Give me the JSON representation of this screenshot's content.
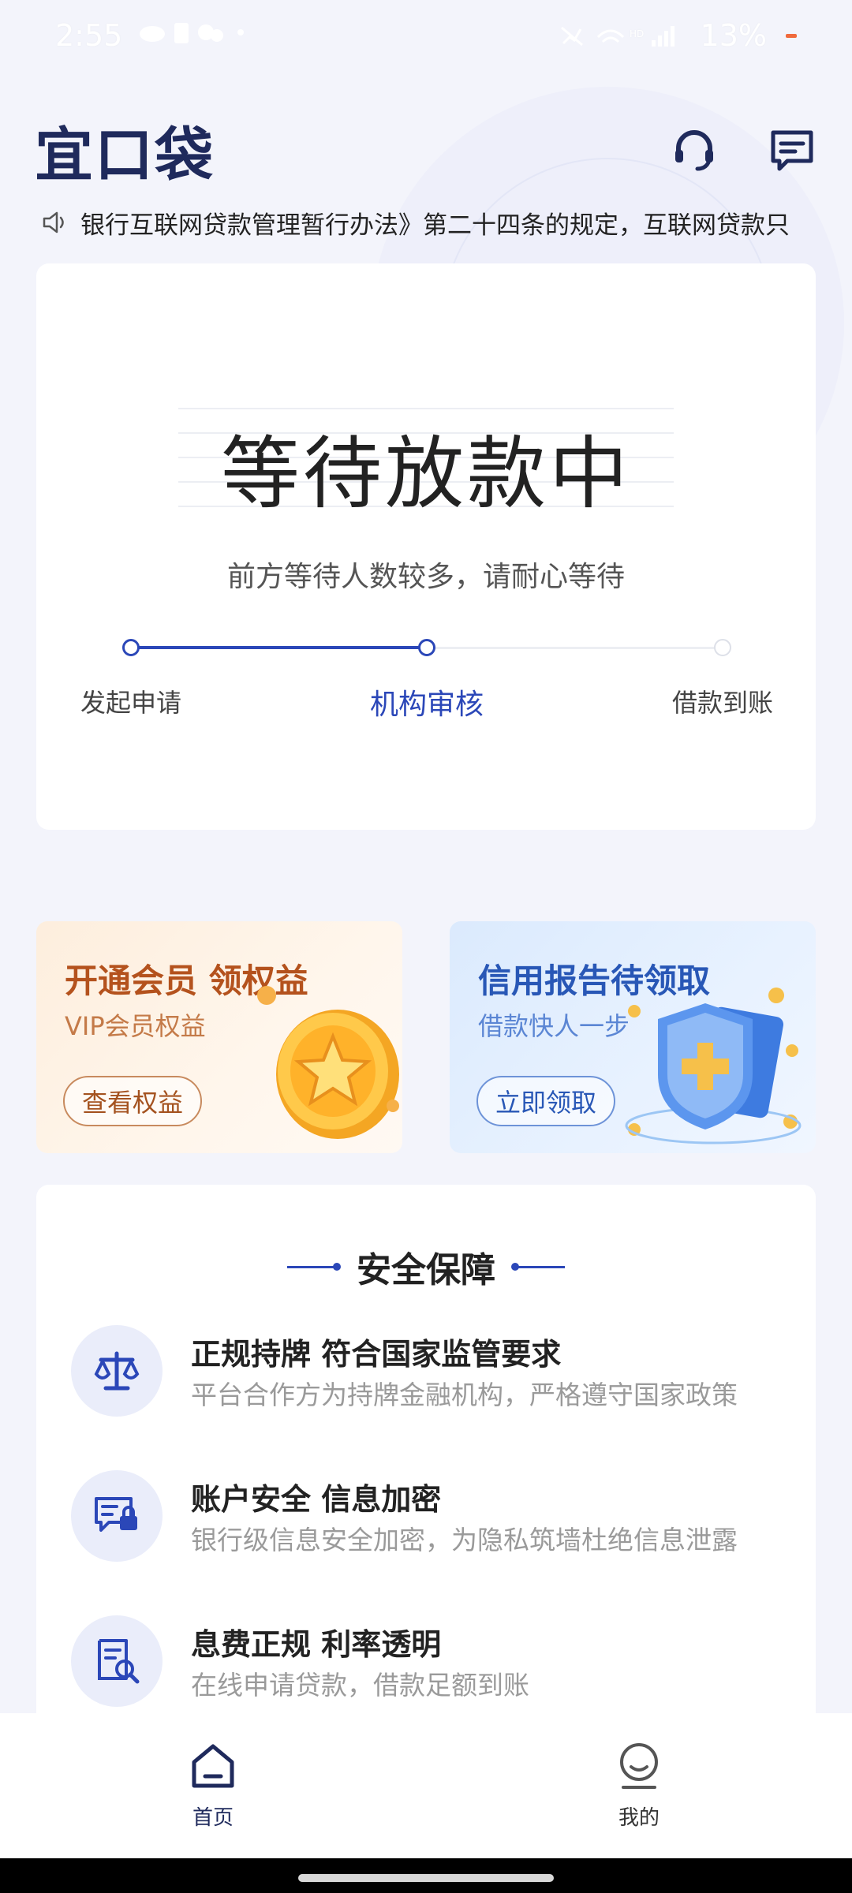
{
  "status_bar": {
    "time": "2:55",
    "battery": "13%"
  },
  "header": {
    "logo": "宜口袋"
  },
  "notice": {
    "text": "银行互联网贷款管理暂行办法》第二十四条的规定，互联网贷款只"
  },
  "loan_status": {
    "title": "等待放款中",
    "subtitle": "前方等待人数较多，请耐心等待",
    "steps": [
      "发起申请",
      "机构审核",
      "借款到账"
    ],
    "active_step": 1
  },
  "promos": {
    "vip": {
      "title": "开通会员 领权益",
      "subtitle": "VIP会员权益",
      "button": "查看权益"
    },
    "credit": {
      "title": "信用报告待领取",
      "subtitle": "借款快人一步",
      "button": "立即领取"
    }
  },
  "security": {
    "title": "安全保障",
    "items": [
      {
        "title": "正规持牌 符合国家监管要求",
        "desc": "平台合作方为持牌金融机构，严格遵守国家政策",
        "icon": "scale-icon"
      },
      {
        "title": "账户安全 信息加密",
        "desc": "银行级信息安全加密，为隐私筑墙杜绝信息泄露",
        "icon": "secure-message-icon"
      },
      {
        "title": "息费正规  利率透明",
        "desc": "在线申请贷款，借款足额到账",
        "icon": "document-search-icon"
      }
    ]
  },
  "bottom_nav": {
    "items": [
      {
        "label": "首页",
        "icon": "home-icon",
        "active": true
      },
      {
        "label": "我的",
        "icon": "profile-icon",
        "active": false
      }
    ]
  },
  "colors": {
    "primary": "#2b47b8",
    "logo": "#1f2a5c",
    "vip_text": "#b4521d",
    "credit_text": "#2857b6"
  }
}
